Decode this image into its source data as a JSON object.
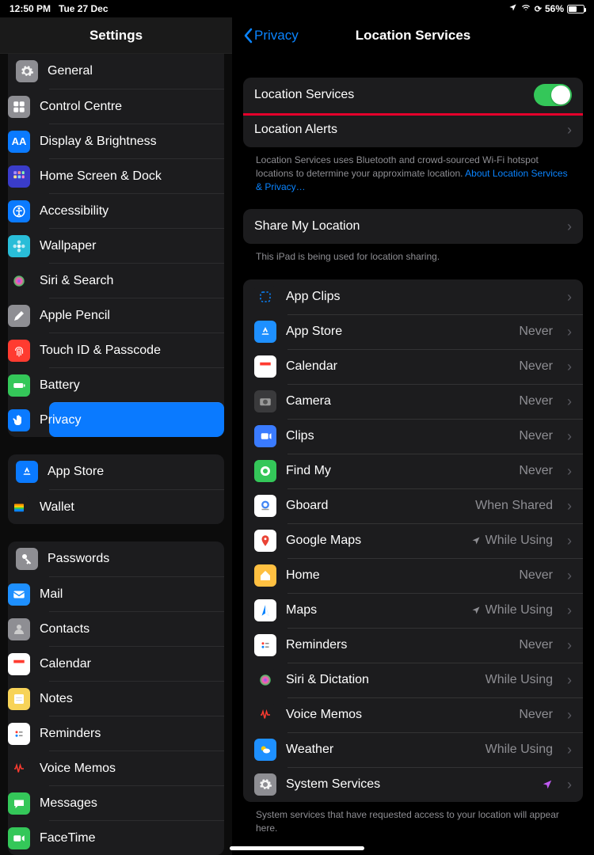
{
  "status": {
    "time": "12:50 PM",
    "date": "Tue 27 Dec",
    "battery_pct": "56%",
    "battery_fill": 56
  },
  "sidebar": {
    "title": "Settings",
    "groups": [
      {
        "items": [
          {
            "label": "General",
            "icon": "gear",
            "bg": "#8e8e93"
          },
          {
            "label": "Control Centre",
            "icon": "cc",
            "bg": "#8e8e93"
          },
          {
            "label": "Display & Brightness",
            "icon": "AA",
            "bg": "#0a7aff"
          },
          {
            "label": "Home Screen & Dock",
            "icon": "grid",
            "bg": "#3a3cc9"
          },
          {
            "label": "Accessibility",
            "icon": "acc",
            "bg": "#0a7aff"
          },
          {
            "label": "Wallpaper",
            "icon": "flower",
            "bg": "#29bdd8"
          },
          {
            "label": "Siri & Search",
            "icon": "siri",
            "bg": "#1c1c1e"
          },
          {
            "label": "Apple Pencil",
            "icon": "pencil",
            "bg": "#8e8e93"
          },
          {
            "label": "Touch ID & Passcode",
            "icon": "finger",
            "bg": "#ff3b30"
          },
          {
            "label": "Battery",
            "icon": "batt",
            "bg": "#34c759"
          },
          {
            "label": "Privacy",
            "icon": "hand",
            "bg": "#0a7aff",
            "active": true
          }
        ]
      },
      {
        "items": [
          {
            "label": "App Store",
            "icon": "A",
            "bg": "#0a7aff"
          },
          {
            "label": "Wallet",
            "icon": "wallet",
            "bg": "#1c1c1e"
          }
        ]
      },
      {
        "items": [
          {
            "label": "Passwords",
            "icon": "key",
            "bg": "#8e8e93"
          },
          {
            "label": "Mail",
            "icon": "mail",
            "bg": "#1e90ff"
          },
          {
            "label": "Contacts",
            "icon": "person",
            "bg": "#8e8e93"
          },
          {
            "label": "Calendar",
            "icon": "cal",
            "bg": "#ffffff"
          },
          {
            "label": "Notes",
            "icon": "notes",
            "bg": "#f7d358"
          },
          {
            "label": "Reminders",
            "icon": "rem",
            "bg": "#ffffff"
          },
          {
            "label": "Voice Memos",
            "icon": "wave",
            "bg": "#1c1c1e"
          },
          {
            "label": "Messages",
            "icon": "msg",
            "bg": "#34c759"
          },
          {
            "label": "FaceTime",
            "icon": "ft",
            "bg": "#34c759"
          }
        ]
      }
    ]
  },
  "detail": {
    "back": "Privacy",
    "title": "Location Services",
    "toggle_label": "Location Services",
    "toggle_on": true,
    "alerts_label": "Location Alerts",
    "info": "Location Services uses Bluetooth and crowd-sourced Wi-Fi hotspot locations to determine your approximate location. ",
    "info_link": "About Location Services & Privacy…",
    "share_label": "Share My Location",
    "share_note": "This iPad is being used for location sharing.",
    "apps": [
      {
        "label": "App Clips",
        "value": "",
        "icon": "clip",
        "bg": "#1c1c1e"
      },
      {
        "label": "App Store",
        "value": "Never",
        "icon": "A",
        "bg": "#1e90ff"
      },
      {
        "label": "Calendar",
        "value": "Never",
        "icon": "cal",
        "bg": "#ffffff"
      },
      {
        "label": "Camera",
        "value": "Never",
        "icon": "cam",
        "bg": "#3a3a3c"
      },
      {
        "label": "Clips",
        "value": "Never",
        "icon": "clips",
        "bg": "#3a7bff"
      },
      {
        "label": "Find My",
        "value": "Never",
        "icon": "find",
        "bg": "#34c759"
      },
      {
        "label": "Gboard",
        "value": "When Shared",
        "icon": "gb",
        "bg": "#ffffff"
      },
      {
        "label": "Google Maps",
        "value": "While Using",
        "arrow": true,
        "icon": "gm",
        "bg": "#ffffff"
      },
      {
        "label": "Home",
        "value": "Never",
        "icon": "home",
        "bg": "#ffc041"
      },
      {
        "label": "Maps",
        "value": "While Using",
        "arrow": true,
        "icon": "maps",
        "bg": "#ffffff"
      },
      {
        "label": "Reminders",
        "value": "Never",
        "icon": "rem",
        "bg": "#ffffff"
      },
      {
        "label": "Siri & Dictation",
        "value": "While Using",
        "icon": "siri",
        "bg": "#1c1c1e"
      },
      {
        "label": "Voice Memos",
        "value": "Never",
        "icon": "wave",
        "bg": "#1c1c1e"
      },
      {
        "label": "Weather",
        "value": "While Using",
        "icon": "wx",
        "bg": "#1e90ff"
      },
      {
        "label": "System Services",
        "value": "",
        "purple_arrow": true,
        "icon": "gear",
        "bg": "#8e8e93"
      }
    ],
    "sys_note": "System services that have requested access to your location will appear here."
  }
}
